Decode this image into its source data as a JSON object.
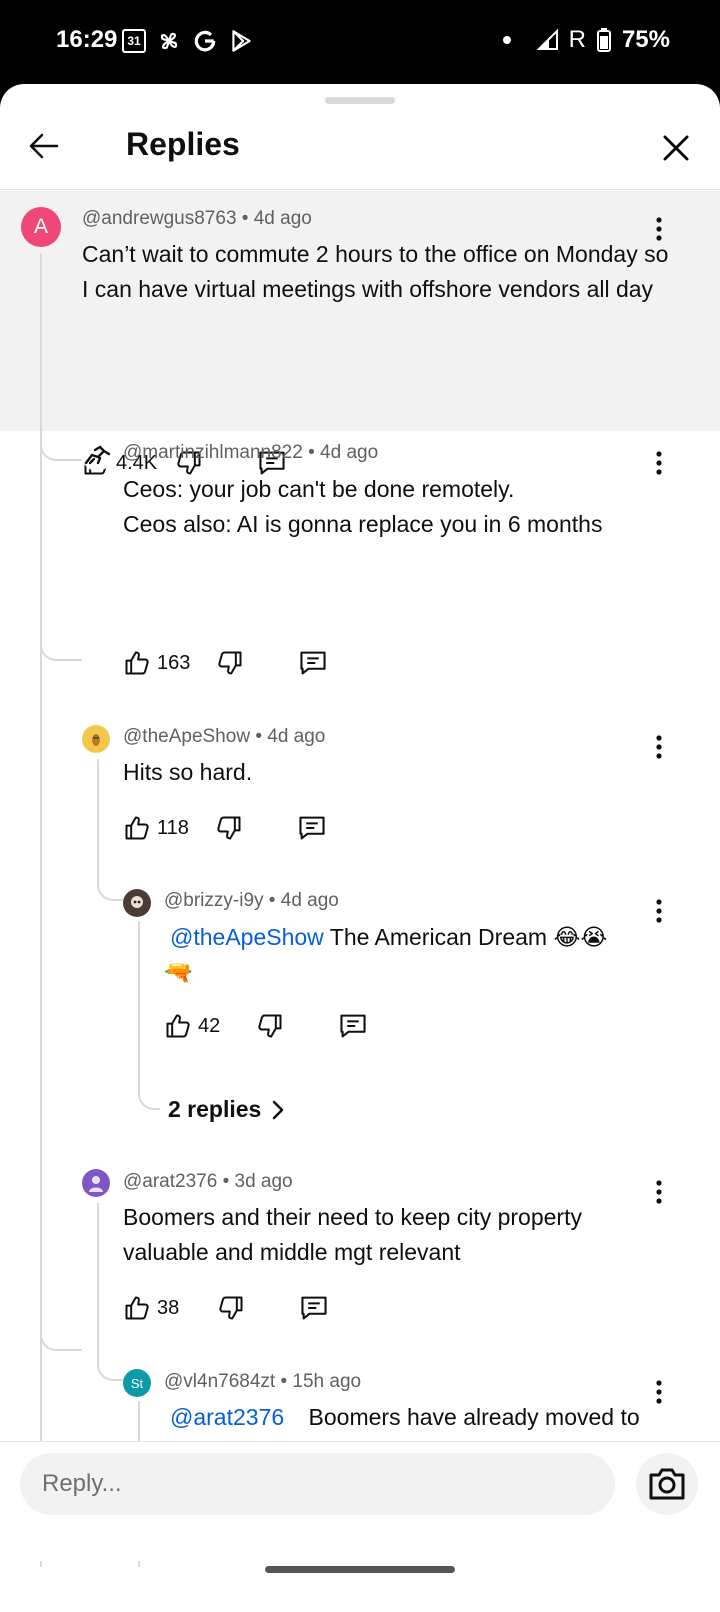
{
  "status_bar": {
    "time": "16:29",
    "calendar_day": "31",
    "network_label": "R",
    "battery": "75%"
  },
  "header": {
    "title": "Replies"
  },
  "comments": [
    {
      "author": "@andrewgus8763",
      "age": "4d ago",
      "avatar_letter": "A",
      "avatar_color": "#ef4778",
      "text": "Can’t wait to commute 2 hours to the office on Monday so I can have virtual meetings with offshore vendors all day",
      "likes": "4.4K"
    },
    {
      "author": "@martinzihlmann822",
      "age": "4d ago",
      "text_line1": "Ceos: your job can't be done remotely.",
      "text_line2": "Ceos also: AI is gonna replace you in 6 months",
      "likes": "163"
    },
    {
      "author": "@theApeShow",
      "age": "4d ago",
      "avatar_color": "#f2c94c",
      "text": "Hits so hard.",
      "likes": "118"
    },
    {
      "author": "@brizzy-i9y",
      "age": "4d ago",
      "mention": "@theApeShow",
      "text": "The American Dream 😂😭",
      "text_line2": "🔫",
      "likes": "42"
    },
    {
      "author": "@arat2376",
      "age": "3d ago",
      "avatar_color": "#7e57c2",
      "text": "Boomers and their need to keep city property valuable and middle mgt relevant",
      "likes": "38"
    },
    {
      "author": "@vl4n7684zt",
      "age": "15h ago",
      "avatar_letter": "St",
      "avatar_color": "#0d9aa8",
      "mention": "@arat2376",
      "text": "Boomers have already moved to the 'burbs."
    }
  ],
  "more_replies": "2 replies",
  "reply_bar": {
    "placeholder": "Reply..."
  },
  "colors": {
    "highlight_bg": "#f2f2f2",
    "mention": "#065fd4",
    "thread_line": "#d9d9d9"
  },
  "icons": [
    "back-arrow-icon",
    "close-icon",
    "thumb-up-icon",
    "thumb-down-icon",
    "comment-reply-icon",
    "more-vert-icon",
    "chevron-right-icon",
    "camera-icon"
  ]
}
